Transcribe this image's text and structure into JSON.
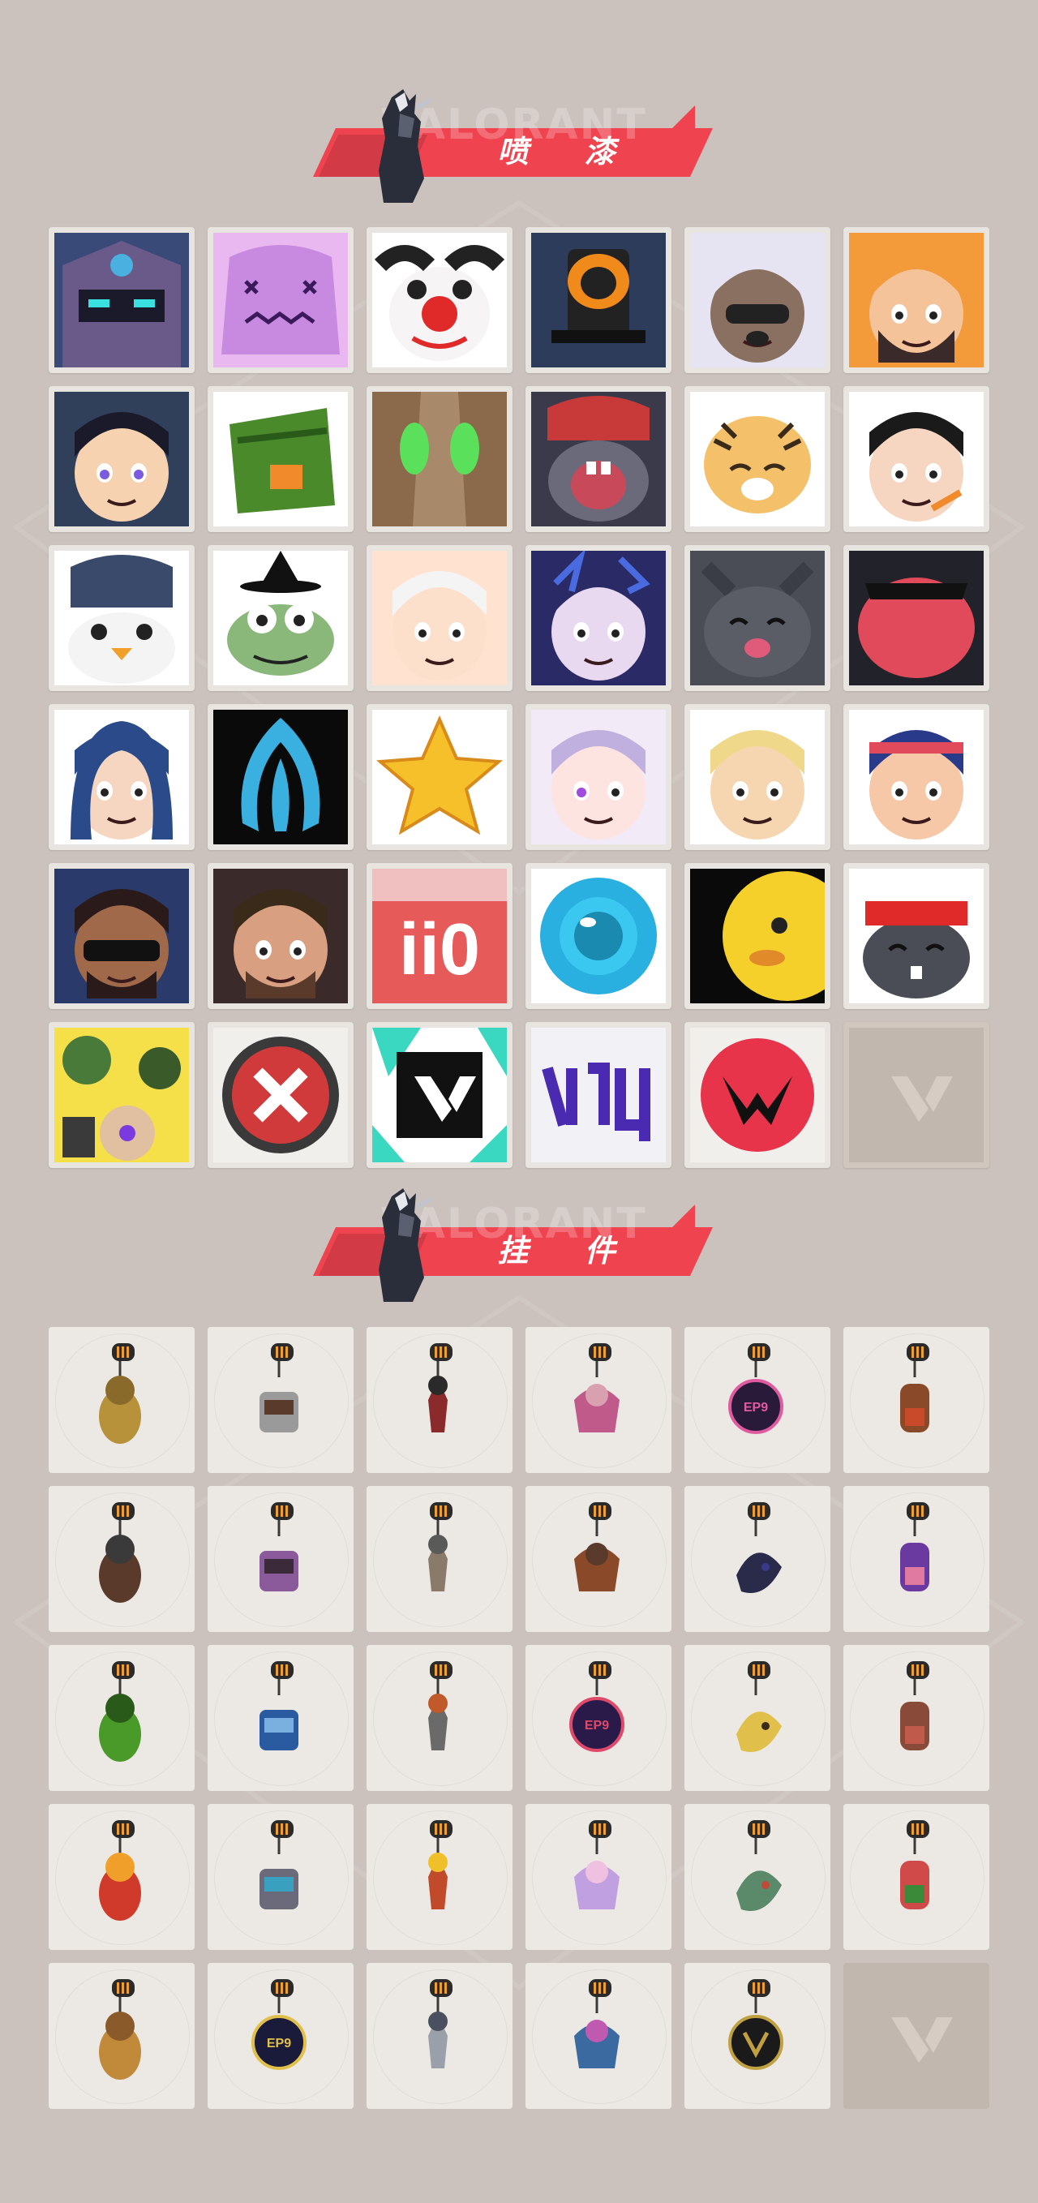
{
  "sections": {
    "sprays": {
      "title": "喷 漆",
      "watermark": "VALORANT"
    },
    "buddies": {
      "title": "挂 件",
      "watermark": "VALORANT"
    }
  },
  "colors": {
    "background": "#cbc2bd",
    "accent": "#ef4450",
    "tile_frame": "#e8e5e1",
    "tile_empty": "#c2b7ae"
  },
  "sprays": [
    {
      "name": "armored-hero-spray-icon",
      "bg": "#3a4a78"
    },
    {
      "name": "purple-blob-spray-icon",
      "bg": "#e9b8f0"
    },
    {
      "name": "clown-spray-icon",
      "bg": "#ffffff"
    },
    {
      "name": "top-hat-spray-icon",
      "bg": "#2c3c5a"
    },
    {
      "name": "raccoon-spray-icon",
      "bg": "#e6e4f2"
    },
    {
      "name": "bearded-agent-spray-icon",
      "bg": "#f39a3a"
    },
    {
      "name": "dark-haired-kid-spray-icon",
      "bg": "#30405a"
    },
    {
      "name": "green-crate-spray-icon",
      "bg": "#ffffff"
    },
    {
      "name": "green-eyes-spray-icon",
      "bg": "#a88a6a"
    },
    {
      "name": "crying-creature-spray-icon",
      "bg": "#3a3a4a"
    },
    {
      "name": "tiger-spray-icon",
      "bg": "#ffffff"
    },
    {
      "name": "black-haired-girl-spray-icon",
      "bg": "#ffffff"
    },
    {
      "name": "penguin-spray-icon",
      "bg": "#ffffff"
    },
    {
      "name": "frog-witch-spray-icon",
      "bg": "#ffffff"
    },
    {
      "name": "smug-face-spray-icon",
      "bg": "#ffe2d0"
    },
    {
      "name": "blue-haired-agent-spray-icon",
      "bg": "#2a2a66"
    },
    {
      "name": "grey-cat-spray-icon",
      "bg": "#4a4d55"
    },
    {
      "name": "red-mouth-spray-icon",
      "bg": "#22222a"
    },
    {
      "name": "hooded-agent-spray-icon",
      "bg": "#ffffff"
    },
    {
      "name": "blue-flame-spray-icon",
      "bg": "#0a0a0a"
    },
    {
      "name": "gold-star-spray-icon",
      "bg": "#ffffff"
    },
    {
      "name": "winking-girl-spray-icon",
      "bg": "#f2eaf6"
    },
    {
      "name": "blonde-agent-spray-icon",
      "bg": "#ffffff"
    },
    {
      "name": "bandana-girl-spray-icon",
      "bg": "#ffffff"
    },
    {
      "name": "sunglasses-agent-spray-icon",
      "bg": "#2a3a6a"
    },
    {
      "name": "bearded-man-spray-icon",
      "bg": "#3a2a2a"
    },
    {
      "name": "score-ii0-spray-icon",
      "bg": "#e65a5a"
    },
    {
      "name": "blue-orb-spray-icon",
      "bg": "#ffffff"
    },
    {
      "name": "yellow-chick-spray-icon",
      "bg": "#0a0a0a"
    },
    {
      "name": "headband-rabbit-spray-icon",
      "bg": "#ffffff"
    },
    {
      "name": "grenades-spray-icon",
      "bg": "#f5e04a"
    },
    {
      "name": "red-x-spray-icon",
      "bg": "#f1efec"
    },
    {
      "name": "valorant-logo-spray-icon",
      "bg": "#ffffff"
    },
    {
      "name": "graffiti-tag-spray-icon",
      "bg": "#f2f2f6"
    },
    {
      "name": "red-v-badge-spray-icon",
      "bg": "#f1efec"
    },
    {
      "name": "empty-slot-icon",
      "bg": "#c2b7ae"
    }
  ],
  "buddies": [
    {
      "name": "gold-bear-buddy-icon",
      "c1": "#b8923a",
      "c2": "#8a6a2a"
    },
    {
      "name": "tray-buddy-icon",
      "c1": "#9a9a9a",
      "c2": "#5a3a2a"
    },
    {
      "name": "rope-knot-buddy-icon",
      "c1": "#8a2a2a",
      "c2": "#2a2a2a"
    },
    {
      "name": "cupcake-buddy-icon",
      "c1": "#c05a8a",
      "c2": "#d9a0b0"
    },
    {
      "name": "ep9-medal-buddy-icon",
      "c1": "#2a1a3a",
      "c2": "#e05aa0"
    },
    {
      "name": "teddy-bell-buddy-icon",
      "c1": "#8a4a2a",
      "c2": "#c84a2a"
    },
    {
      "name": "wooden-gun-buddy-icon",
      "c1": "#5a3a2a",
      "c2": "#3a3a3a"
    },
    {
      "name": "agent-figure-buddy-icon",
      "c1": "#8a5a9a",
      "c2": "#3a2a3a"
    },
    {
      "name": "cowboy-robot-buddy-icon",
      "c1": "#8a7a6a",
      "c2": "#5a5a5a"
    },
    {
      "name": "leather-bag-buddy-icon",
      "c1": "#8a4a2a",
      "c2": "#5a3a2a"
    },
    {
      "name": "dark-jester-buddy-icon",
      "c1": "#2a2a4a",
      "c2": "#3a3a8a"
    },
    {
      "name": "lava-lamp-buddy-icon",
      "c1": "#6a3aa0",
      "c2": "#e07aa0"
    },
    {
      "name": "green-pager-buddy-icon",
      "c1": "#4a9a2a",
      "c2": "#2a5a1a"
    },
    {
      "name": "blue-astronaut-buddy-icon",
      "c1": "#2a5aa0",
      "c2": "#7ab0e0"
    },
    {
      "name": "radio-box-buddy-icon",
      "c1": "#6a6a6a",
      "c2": "#c05a2a"
    },
    {
      "name": "ep9-badge-buddy-icon",
      "c1": "#2a1a4a",
      "c2": "#e04a6a"
    },
    {
      "name": "banana-buddy-icon",
      "c1": "#e0c04a",
      "c2": "#3a2a1a"
    },
    {
      "name": "ice-pop-buddy-icon",
      "c1": "#8a4a3a",
      "c2": "#c05a4a"
    },
    {
      "name": "chili-skewer-buddy-icon",
      "c1": "#d03a2a",
      "c2": "#f0a02a"
    },
    {
      "name": "grey-agent-buddy-icon",
      "c1": "#6a6a7a",
      "c2": "#3aa0c0"
    },
    {
      "name": "hot-air-balloon-buddy-icon",
      "c1": "#c04a2a",
      "c2": "#f0c02a"
    },
    {
      "name": "pink-girl-buddy-icon",
      "c1": "#c0a0e0",
      "c2": "#f0c0e0"
    },
    {
      "name": "robot-chef-buddy-icon",
      "c1": "#5a8a6a",
      "c2": "#c04a3a"
    },
    {
      "name": "watermelon-buddy-icon",
      "c1": "#d04a4a",
      "c2": "#3a8a3a"
    },
    {
      "name": "beehive-buddy-icon",
      "c1": "#c08a3a",
      "c2": "#8a5a2a"
    },
    {
      "name": "ep9-gold-medal-buddy-icon",
      "c1": "#1a1a3a",
      "c2": "#e0c04a"
    },
    {
      "name": "silver-claw-buddy-icon",
      "c1": "#9aa0aa",
      "c2": "#4a5060"
    },
    {
      "name": "ufo-buddy-icon",
      "c1": "#3a6aa0",
      "c2": "#c05ab0"
    },
    {
      "name": "v-medal-buddy-icon",
      "c1": "#1a1a1a",
      "c2": "#c0a040"
    },
    {
      "name": "empty-slot-icon",
      "c1": "#c2b7ae",
      "c2": "#c2b7ae"
    }
  ]
}
